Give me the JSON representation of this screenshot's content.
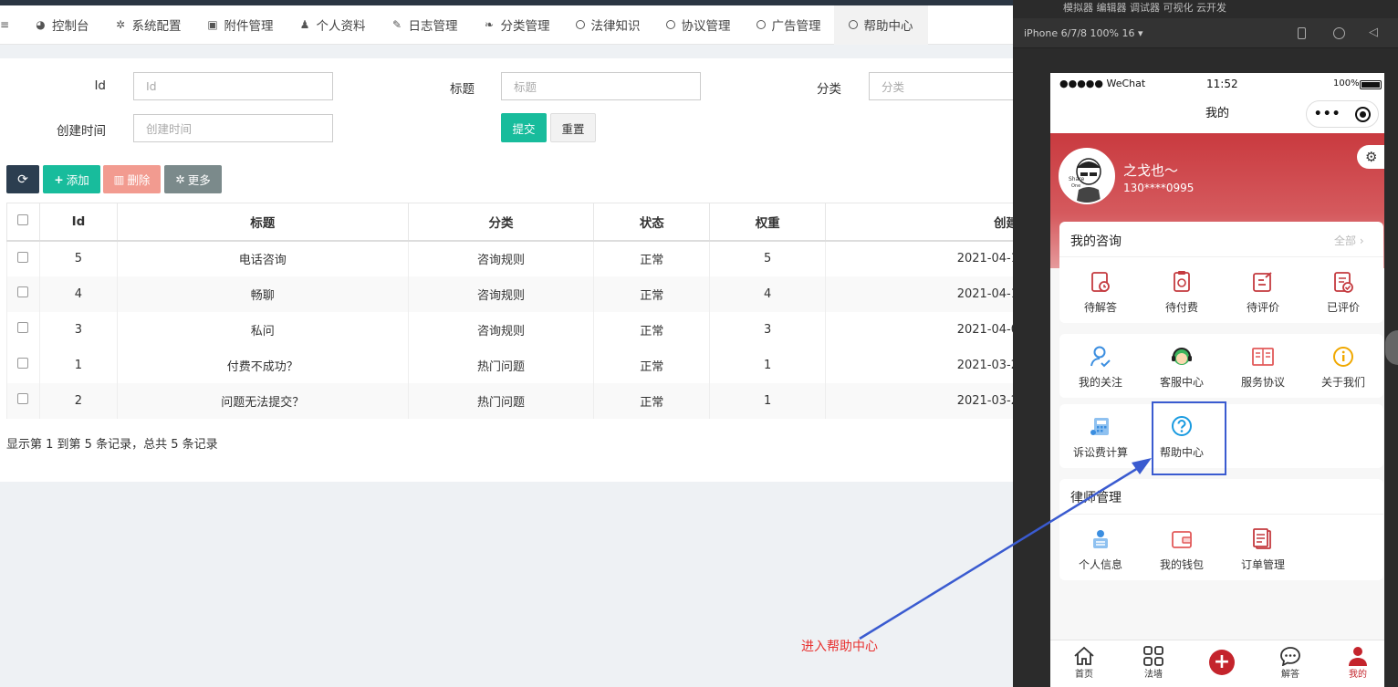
{
  "tabs": [
    {
      "icon": "dashboard-icon",
      "label": "控制台"
    },
    {
      "icon": "gear-icon",
      "label": "系统配置"
    },
    {
      "icon": "file-icon",
      "label": "附件管理"
    },
    {
      "icon": "user-icon",
      "label": "个人资料"
    },
    {
      "icon": "pen-icon",
      "label": "日志管理"
    },
    {
      "icon": "leaf-icon",
      "label": "分类管理"
    },
    {
      "icon": "circle-icon",
      "label": "法律知识"
    },
    {
      "icon": "circle-icon",
      "label": "协议管理"
    },
    {
      "icon": "circle-icon",
      "label": "广告管理"
    },
    {
      "icon": "circle-icon",
      "label": "帮助中心"
    }
  ],
  "filters": {
    "id_label": "Id",
    "id_placeholder": "Id",
    "title_label": "标题",
    "title_placeholder": "标题",
    "category_label": "分类",
    "category_placeholder": "分类",
    "created_label": "创建时间",
    "created_placeholder": "创建时间",
    "submit": "提交",
    "reset": "重置"
  },
  "toolbar": {
    "add": "添加",
    "delete": "删除",
    "more": "更多"
  },
  "table": {
    "headers": {
      "id": "Id",
      "title": "标题",
      "category": "分类",
      "status": "状态",
      "weight": "权重",
      "created": "创建"
    },
    "rows": [
      {
        "id": "5",
        "title": "电话咨询",
        "category": "咨询规则",
        "status": "正常",
        "weight": "5",
        "created": "2021-04-1"
      },
      {
        "id": "4",
        "title": "畅聊",
        "category": "咨询规则",
        "status": "正常",
        "weight": "4",
        "created": "2021-04-1"
      },
      {
        "id": "3",
        "title": "私问",
        "category": "咨询规则",
        "status": "正常",
        "weight": "3",
        "created": "2021-04-0"
      },
      {
        "id": "1",
        "title": "付费不成功？",
        "category": "热门问题",
        "status": "正常",
        "weight": "1",
        "created": "2021-03-2"
      },
      {
        "id": "2",
        "title": "问题无法提交？",
        "category": "热门问题",
        "status": "正常",
        "weight": "1",
        "created": "2021-03-2"
      }
    ]
  },
  "summary": "显示第 1 到第 5 条记录，总共 5 条记录",
  "devtools": {
    "top_menu": "模拟器  编辑器  调试器  可视化  云开发",
    "device": "iPhone 6/7/8 100% 16 ▾"
  },
  "phone": {
    "carrier": "●●●●● WeChat",
    "time": "11:52",
    "battery": "100%",
    "nav_title": "我的",
    "user_name": "之戈也～",
    "user_phone": "130****0995",
    "consult": {
      "title": "我的咨询",
      "all": "全部",
      "items": [
        "待解答",
        "待付费",
        "待评价",
        "已评价"
      ]
    },
    "services": [
      "我的关注",
      "客服中心",
      "服务协议",
      "关于我们"
    ],
    "tools": [
      "诉讼费计算",
      "帮助中心"
    ],
    "lawyer": {
      "title": "律师管理",
      "items": [
        "个人信息",
        "我的钱包",
        "订单管理"
      ]
    },
    "tabbar": [
      "首页",
      "法墙",
      "",
      "解答",
      "我的"
    ]
  },
  "annotation": {
    "text": "进入帮助中心",
    "color": "#e8312f",
    "arrow_color": "#3a5bd0"
  }
}
